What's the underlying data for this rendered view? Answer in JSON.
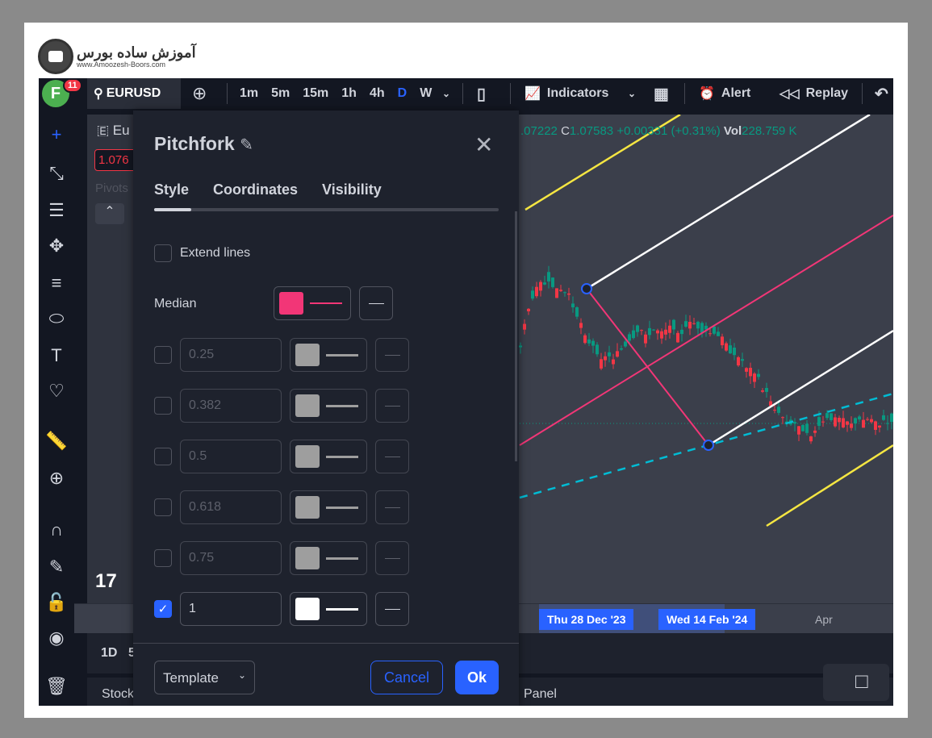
{
  "logo": {
    "text_fa": "آموزش ساده بورس",
    "url": "www.Amoozesh-Boors.com"
  },
  "topbar": {
    "avatar": "F",
    "badge": "11",
    "symbol": "EURUSD",
    "timeframes": [
      "1m",
      "5m",
      "15m",
      "1h",
      "4h",
      "D",
      "W"
    ],
    "active_timeframe": "D",
    "indicators": "Indicators",
    "alert": "Alert",
    "replay": "Replay"
  },
  "legend": {
    "symbol": "Eu",
    "price": "1.076",
    "pivots": "Pivots",
    "ohlc": {
      "l": ".07222",
      "c_label": "C",
      "c": "1.07583",
      "change": "+0.00331 (+0.31%)",
      "vol_label": "Vol",
      "vol": "228.759 K"
    }
  },
  "colors": {
    "accent": "#2962ff",
    "median": "#f23677",
    "up": "#089981",
    "down": "#f23645",
    "yellow": "#f5e642",
    "cyan": "#00bcd4"
  },
  "time_axis": {
    "labels": [
      "Thu 28 Dec '23",
      "Wed 14 Feb '24",
      "Apr"
    ]
  },
  "bottom": {
    "range": "1D",
    "range2": "5",
    "stock": "Stock",
    "panel": "Panel"
  },
  "dialog": {
    "title": "Pitchfork",
    "tabs": [
      "Style",
      "Coordinates",
      "Visibility"
    ],
    "active_tab": "Style",
    "extend_lines": {
      "label": "Extend lines",
      "checked": false
    },
    "median": {
      "label": "Median",
      "color": "#f23677"
    },
    "levels": [
      {
        "value": "0.25",
        "checked": false,
        "color": "#9e9e9e"
      },
      {
        "value": "0.382",
        "checked": false,
        "color": "#9e9e9e"
      },
      {
        "value": "0.5",
        "checked": false,
        "color": "#9e9e9e"
      },
      {
        "value": "0.618",
        "checked": false,
        "color": "#9e9e9e"
      },
      {
        "value": "0.75",
        "checked": false,
        "color": "#9e9e9e"
      },
      {
        "value": "1",
        "checked": true,
        "color": "#ffffff"
      }
    ],
    "template": "Template",
    "cancel": "Cancel",
    "ok": "Ok"
  }
}
